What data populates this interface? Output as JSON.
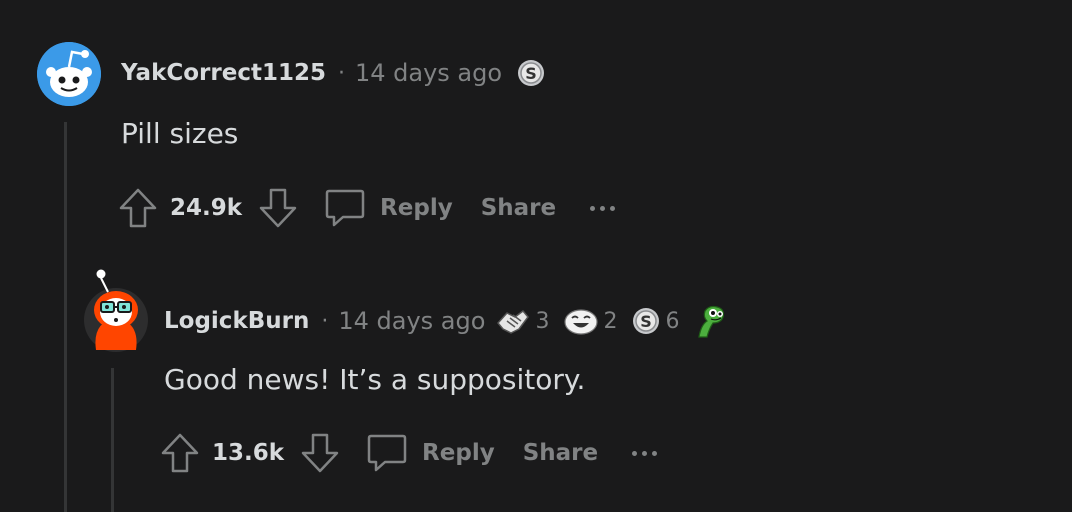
{
  "comments": [
    {
      "username": "YakCorrect1125",
      "separator": "·",
      "time": "14 days ago",
      "body": "Pill sizes",
      "score": "24.9k",
      "reply_label": "Reply",
      "share_label": "Share",
      "awards": [
        {
          "icon": "silver-award-icon",
          "count": ""
        }
      ]
    },
    {
      "username": "LogickBurn",
      "separator": "·",
      "time": "14 days ago",
      "body": "Good news! It’s a suppository.",
      "score": "13.6k",
      "reply_label": "Reply",
      "share_label": "Share",
      "awards": [
        {
          "icon": "handshake-award-icon",
          "count": "3"
        },
        {
          "icon": "laughing-face-award-icon",
          "count": "2"
        },
        {
          "icon": "silver-award-icon",
          "count": "6"
        },
        {
          "icon": "green-creature-award-icon",
          "count": ""
        }
      ]
    }
  ],
  "colors": {
    "background": "#1a1a1b",
    "text": "#d7dadc",
    "muted": "#818384",
    "thread_line": "#343536",
    "avatar_blue": "#3b9ae8",
    "avatar_orange": "#ff4500"
  }
}
